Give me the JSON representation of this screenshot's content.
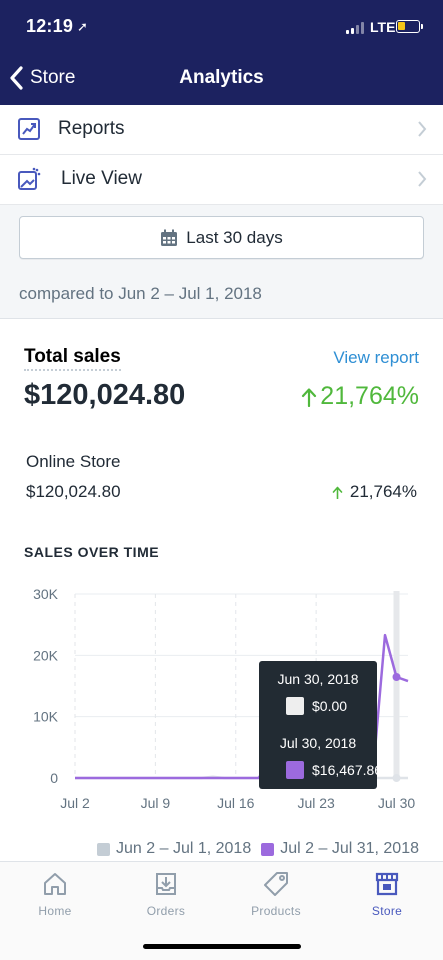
{
  "status_bar": {
    "time": "12:19",
    "network": "LTE",
    "battery_color": "#f5c518"
  },
  "nav": {
    "back_label": "Store",
    "title": "Analytics"
  },
  "menu": [
    {
      "label": "Reports",
      "icon": "reports-icon"
    },
    {
      "label": "Live View",
      "icon": "live-view-icon"
    }
  ],
  "date_range": {
    "button_label": "Last 30 days",
    "compare_text": "compared to Jun 2 – Jul 1, 2018"
  },
  "total_sales": {
    "label": "Total sales",
    "view_report": "View report",
    "value": "$120,024.80",
    "change": "21,764%",
    "channel": {
      "label": "Online Store",
      "value": "$120,024.80",
      "change": "21,764%"
    }
  },
  "sales_over_time": {
    "heading": "SALES OVER TIME",
    "tooltip": {
      "rows": [
        {
          "date": "Jun 30, 2018",
          "value": "$0.00",
          "color": "#eeeeee"
        },
        {
          "date": "Jul 30, 2018",
          "value": "$16,467.86",
          "color": "#9c6ade"
        }
      ]
    },
    "legend": [
      {
        "label": "Jun 2 – Jul 1, 2018",
        "color": "#c4cdd5"
      },
      {
        "label": "Jul 2 – Jul 31, 2018",
        "color": "#9c6ade"
      }
    ]
  },
  "chart_data": {
    "type": "line",
    "title": "SALES OVER TIME",
    "x_tick_labels": [
      "Jul 2",
      "Jul 9",
      "Jul 16",
      "Jul 23",
      "Jul 30"
    ],
    "y_tick_labels": [
      "0",
      "10K",
      "20K",
      "30K"
    ],
    "ylim": [
      0,
      30000
    ],
    "grid": true,
    "legend_position": "bottom",
    "x": [
      "Jul 2",
      "Jul 3",
      "Jul 4",
      "Jul 5",
      "Jul 6",
      "Jul 7",
      "Jul 8",
      "Jul 9",
      "Jul 10",
      "Jul 11",
      "Jul 12",
      "Jul 13",
      "Jul 14",
      "Jul 15",
      "Jul 16",
      "Jul 17",
      "Jul 18",
      "Jul 19",
      "Jul 20",
      "Jul 21",
      "Jul 22",
      "Jul 23",
      "Jul 24",
      "Jul 25",
      "Jul 26",
      "Jul 27",
      "Jul 28",
      "Jul 29",
      "Jul 30",
      "Jul 31"
    ],
    "series": [
      {
        "name": "Jun 2 – Jul 1, 2018",
        "color": "#dfe3e8",
        "values": [
          0,
          0,
          0,
          0,
          0,
          0,
          0,
          0,
          0,
          0,
          0,
          0,
          200,
          0,
          0,
          0,
          0,
          0,
          0,
          0,
          0,
          0,
          0,
          0,
          0,
          0,
          0,
          0,
          0,
          0
        ]
      },
      {
        "name": "Jul 2 – Jul 31, 2018",
        "color": "#9c6ade",
        "values": [
          0,
          0,
          0,
          0,
          0,
          0,
          0,
          0,
          0,
          0,
          0,
          0,
          0,
          0,
          0,
          0,
          0,
          2800,
          0,
          0,
          0,
          2500,
          300,
          1200,
          5000,
          1400,
          2000,
          23300,
          16468,
          15800
        ]
      }
    ],
    "highlight_index": 28
  },
  "tabs": [
    {
      "label": "Home",
      "active": false
    },
    {
      "label": "Orders",
      "active": false
    },
    {
      "label": "Products",
      "active": false
    },
    {
      "label": "Store",
      "active": true
    }
  ],
  "colors": {
    "nav_bg": "#1c2260",
    "accent": "#4959bd",
    "link": "#2f8fd4",
    "positive": "#50b83c"
  }
}
